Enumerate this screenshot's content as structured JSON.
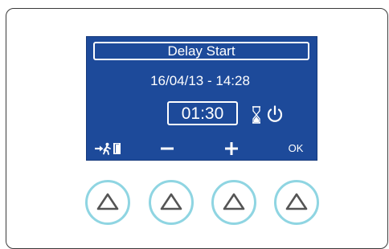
{
  "display": {
    "title": "Delay Start",
    "datetime": "16/04/13 - 14:28",
    "delay_duration": "01:30",
    "status_icons": [
      "hourglass-icon",
      "power-icon"
    ],
    "softkeys": {
      "exit_icon": "exit-door-icon",
      "minus_icon": "minus-icon",
      "plus_icon": "plus-icon",
      "ok_label": "OK"
    }
  },
  "buttons": {
    "count": 4,
    "icon": "up-triangle-icon"
  },
  "colors": {
    "screen_background": "#1d4a9a",
    "screen_text": "#ffffff",
    "button_ring": "#8fd5e2",
    "button_triangle": "#555555",
    "panel_border": "#3a3a3a"
  }
}
